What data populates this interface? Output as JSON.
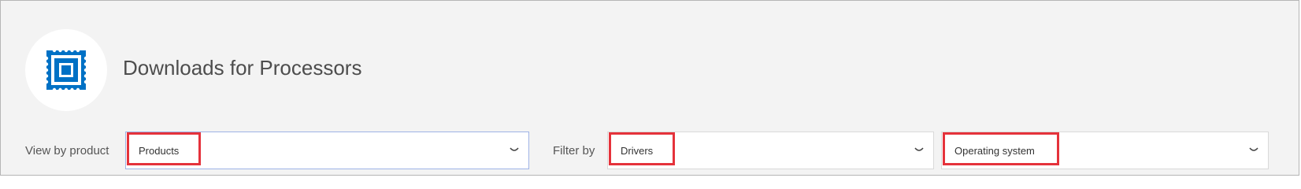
{
  "header": {
    "icon": "processor-chip-icon",
    "title": "Downloads for Processors"
  },
  "filters": {
    "view_by_product": {
      "label": "View by product",
      "value": "Products"
    },
    "filter_by": {
      "label": "Filter by",
      "value": "Drivers"
    },
    "operating_system": {
      "value": "Operating system"
    }
  },
  "colors": {
    "accent": "#0071c5",
    "highlight": "#e5323b",
    "background": "#f3f3f3"
  }
}
